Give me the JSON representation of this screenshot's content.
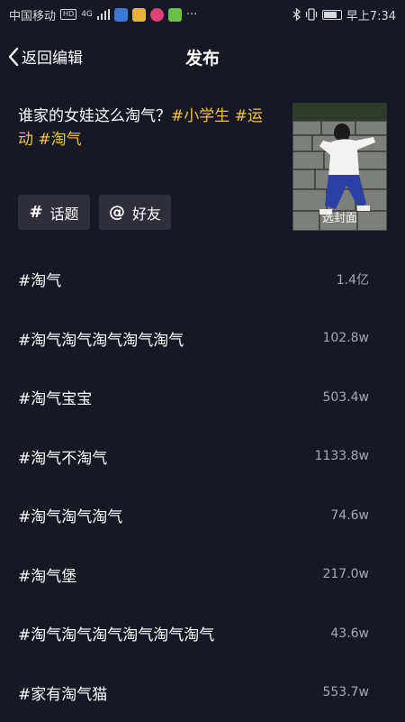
{
  "status_bar": {
    "carrier": "中国移动",
    "network_badge": "HD",
    "signal_label": "4G",
    "more": "···",
    "time": "早上7:34"
  },
  "header": {
    "back_label": "返回编辑",
    "title": "发布"
  },
  "compose": {
    "text": "谁家的女娃这么淘气？",
    "tags": [
      "#小学生",
      "#运动",
      "#淘气"
    ]
  },
  "cover": {
    "label": "选封面"
  },
  "chips": {
    "topic": {
      "symbol": "#",
      "label": "话题"
    },
    "friend": {
      "symbol": "@",
      "label": "好友"
    }
  },
  "topics": [
    {
      "name": "#淘气",
      "count": "1.4亿"
    },
    {
      "name": "#淘气淘气淘气淘气淘气",
      "count": "102.8w"
    },
    {
      "name": "#淘气宝宝",
      "count": "503.4w"
    },
    {
      "name": "#淘气不淘气",
      "count": "1133.8w"
    },
    {
      "name": "#淘气淘气淘气",
      "count": "74.6w"
    },
    {
      "name": "#淘气堡",
      "count": "217.0w"
    },
    {
      "name": "#淘气淘气淘气淘气淘气淘气",
      "count": "43.6w"
    },
    {
      "name": "#家有淘气猫",
      "count": "553.7w"
    }
  ],
  "colors": {
    "background": "#161823",
    "accent_tag": "#f7c230",
    "chip_bg": "#2e2f38"
  }
}
